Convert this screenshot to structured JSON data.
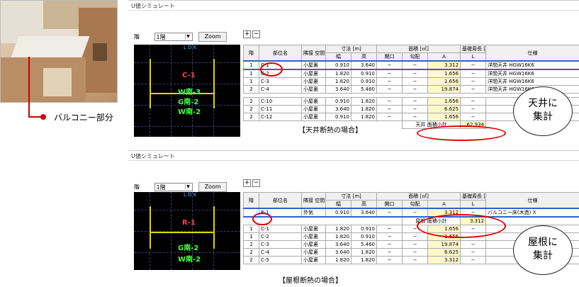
{
  "callout": {
    "label": "バルコニー部分"
  },
  "panels": [
    {
      "window_title": "U値シミュレート",
      "floor_label": "階",
      "floor_value": "1階",
      "zoom_label": "Zoom",
      "plus": "+",
      "minus": "−",
      "plan_texts": {
        "c1": "C-1",
        "g1": "W南-3",
        "g2": "G南-2",
        "g3": "W南-2",
        "ldk": "L D K"
      },
      "headers": {
        "floor": "階",
        "part": "部位名",
        "adjacent": "隣接\n空間",
        "dims": "寸法\n[m]",
        "area": "面積\n[㎡]",
        "perim": "基礎周長\n[m]",
        "spec": "仕様",
        "w": "幅",
        "h": "高",
        "open": "開口",
        "slope": "勾配",
        "a": "A",
        "l": "L"
      },
      "rows": [
        {
          "floor": "1",
          "part": "C-1",
          "adj": "小屋裏",
          "w": "0.910",
          "h": "3.640",
          "open": "−",
          "slope": "−",
          "a": "3.312",
          "l": "−",
          "spec": "洋間天井 HGW16K6"
        },
        {
          "floor": "1",
          "part": "C-2",
          "adj": "小屋裏",
          "w": "1.820",
          "h": "0.910",
          "open": "−",
          "slope": "−",
          "a": "1.656",
          "l": "−",
          "spec": "洋間天井 HGW16K6"
        },
        {
          "floor": "1",
          "part": "C-3",
          "adj": "小屋裏",
          "w": "1.820",
          "h": "0.910",
          "open": "−",
          "slope": "−",
          "a": "1.656",
          "l": "−",
          "spec": "洋間天井 HGW16K6"
        },
        {
          "floor": "2",
          "part": "C-4",
          "adj": "小屋裏",
          "w": "3.640",
          "h": "5.460",
          "open": "−",
          "slope": "−",
          "a": "19.874",
          "l": "−",
          "spec": "洋間天井 HGW16K6"
        },
        {
          "floor": "2",
          "part": "C-10",
          "adj": "小屋裏",
          "w": "0.910",
          "h": "1.820",
          "open": "−",
          "slope": "−",
          "a": "1.656",
          "l": "−",
          "spec": ""
        },
        {
          "floor": "2",
          "part": "C-11",
          "adj": "小屋裏",
          "w": "3.640",
          "h": "1.820",
          "open": "−",
          "slope": "−",
          "a": "6.625",
          "l": "−",
          "spec": ""
        },
        {
          "floor": "2",
          "part": "C-12",
          "adj": "小屋裏",
          "w": "0.910",
          "h": "1.820",
          "open": "−",
          "slope": "−",
          "a": "1.656",
          "l": "−",
          "spec": ""
        }
      ],
      "subtotal_label": "天井 面積小計",
      "subtotal_value": "62.934",
      "caption": "【天井断熱の場合】",
      "bubble": "天井に\n集計"
    },
    {
      "window_title": "U値シミュレート",
      "floor_label": "階",
      "floor_value": "1階",
      "zoom_label": "Zoom",
      "plus": "+",
      "minus": "−",
      "plan_texts": {
        "r1": "R-1",
        "g1": "G南-2",
        "g2": "W南-2",
        "ldk": "L D K"
      },
      "headers": {
        "floor": "階",
        "part": "部位名",
        "adjacent": "隣接\n空間",
        "dims": "寸法\n[m]",
        "area": "面積\n[㎡]",
        "perim": "基礎周長\n[m]",
        "spec": "仕様",
        "w": "幅",
        "h": "高",
        "open": "開口",
        "slope": "勾配",
        "a": "A",
        "l": "L"
      },
      "top_row": {
        "floor": "",
        "part": "R-1",
        "adj": "外気",
        "w": "0.910",
        "h": "3.640",
        "open": "−",
        "slope": "−",
        "a": "3.312",
        "l": "−",
        "spec": "バルコニー床(木造) X"
      },
      "subtotal_label": "屋根 面積小計",
      "subtotal_value": "3.312",
      "rows": [
        {
          "floor": "1",
          "part": "C-1",
          "adj": "小屋裏",
          "w": "1.820",
          "h": "0.910",
          "open": "−",
          "slope": "−",
          "a": "1.656",
          "l": "−"
        },
        {
          "floor": "1",
          "part": "C-2",
          "adj": "小屋裏",
          "w": "1.820",
          "h": "0.910",
          "open": "−",
          "slope": "−",
          "a": "1.656",
          "l": "−"
        },
        {
          "floor": "2",
          "part": "C-3",
          "adj": "小屋裏",
          "w": "3.640",
          "h": "5.460",
          "open": "−",
          "slope": "−",
          "a": "19.874",
          "l": "−"
        },
        {
          "floor": "2",
          "part": "C-4",
          "adj": "小屋裏",
          "w": "3.640",
          "h": "1.820",
          "open": "−",
          "slope": "−",
          "a": "6.625",
          "l": "−"
        },
        {
          "floor": "2",
          "part": "C-5",
          "adj": "小屋裏",
          "w": "1.820",
          "h": "1.820",
          "open": "−",
          "slope": "−",
          "a": "3.312",
          "l": "−"
        }
      ],
      "caption": "【屋根断熱の場合】",
      "bubble": "屋根に\n集計"
    }
  ]
}
